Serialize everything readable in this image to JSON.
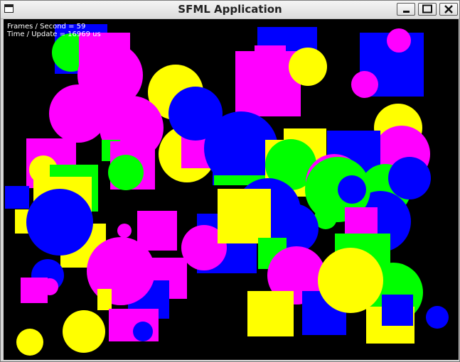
{
  "window": {
    "title": "SFML Application",
    "controls": {
      "minimize": "minimize",
      "maximize": "maximize",
      "close": "close"
    }
  },
  "hud": {
    "fps_line": "Frames / Second = 59",
    "time_line": "Time / Update = 16969 us"
  },
  "palette": {
    "magenta": "#ff00ff",
    "yellow": "#ffff00",
    "blue": "#0000ff",
    "green": "#00ff00",
    "background": "#000000"
  }
}
